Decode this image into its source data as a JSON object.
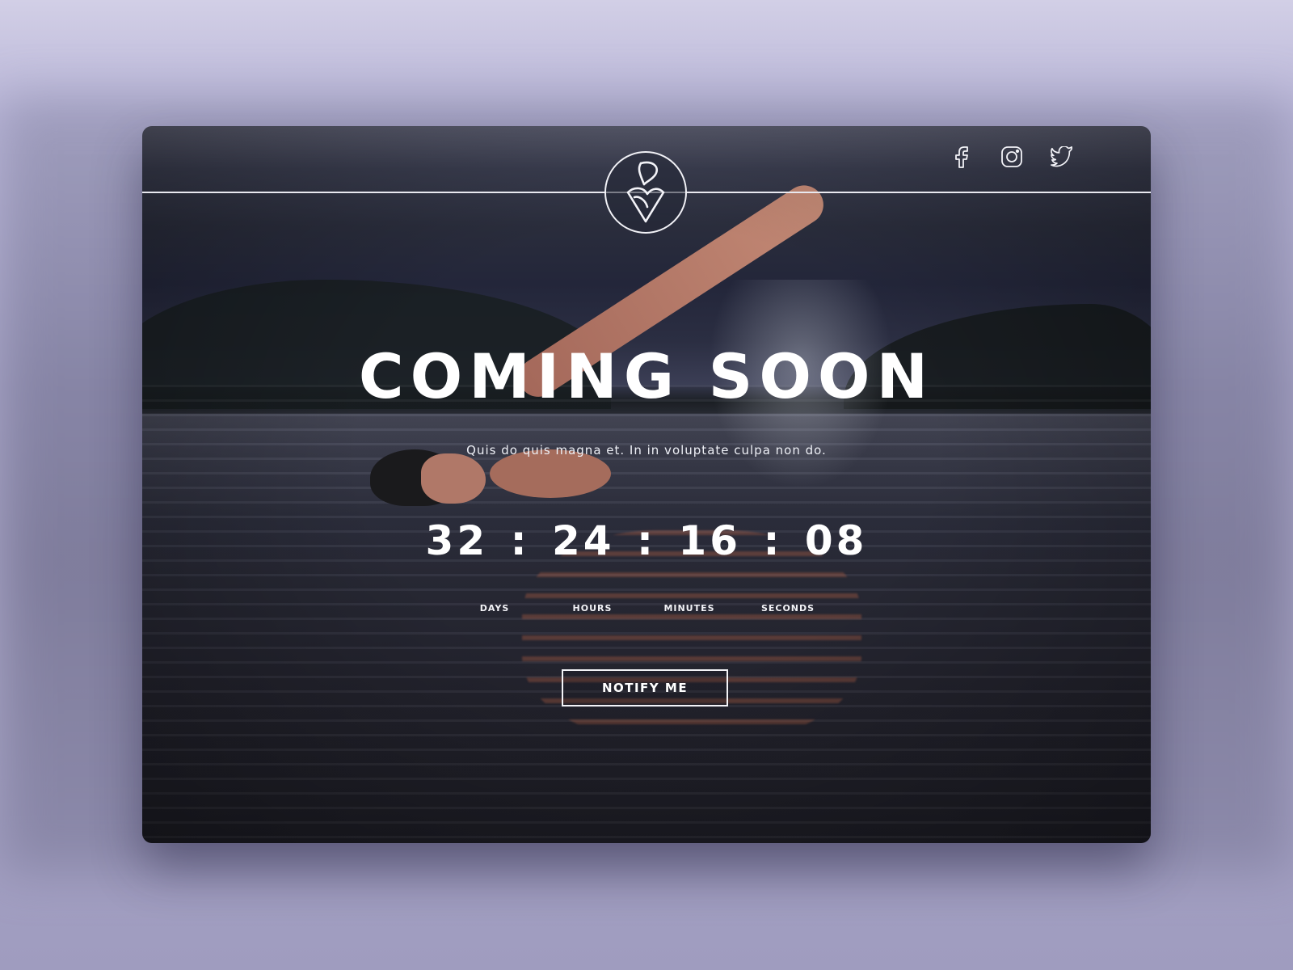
{
  "header": {
    "logo_icon": "swirl-drop-logo-icon",
    "social": [
      {
        "name": "facebook-icon"
      },
      {
        "name": "instagram-icon"
      },
      {
        "name": "twitter-icon"
      }
    ]
  },
  "hero": {
    "title": "COMING SOON",
    "subtitle": "Quis do quis magna et. In in voluptate culpa non do."
  },
  "countdown": {
    "days": "32",
    "hours": "24",
    "minutes": "16",
    "seconds": "08",
    "separator": ":",
    "labels": {
      "days": "DAYS",
      "hours": "HOURS",
      "minutes": "MINUTES",
      "seconds": "SECONDS"
    }
  },
  "cta": {
    "notify_label": "NOTIFY ME"
  },
  "colors": {
    "background": "#b9b6d8",
    "text": "#ffffff",
    "line": "#e9e9f0"
  }
}
